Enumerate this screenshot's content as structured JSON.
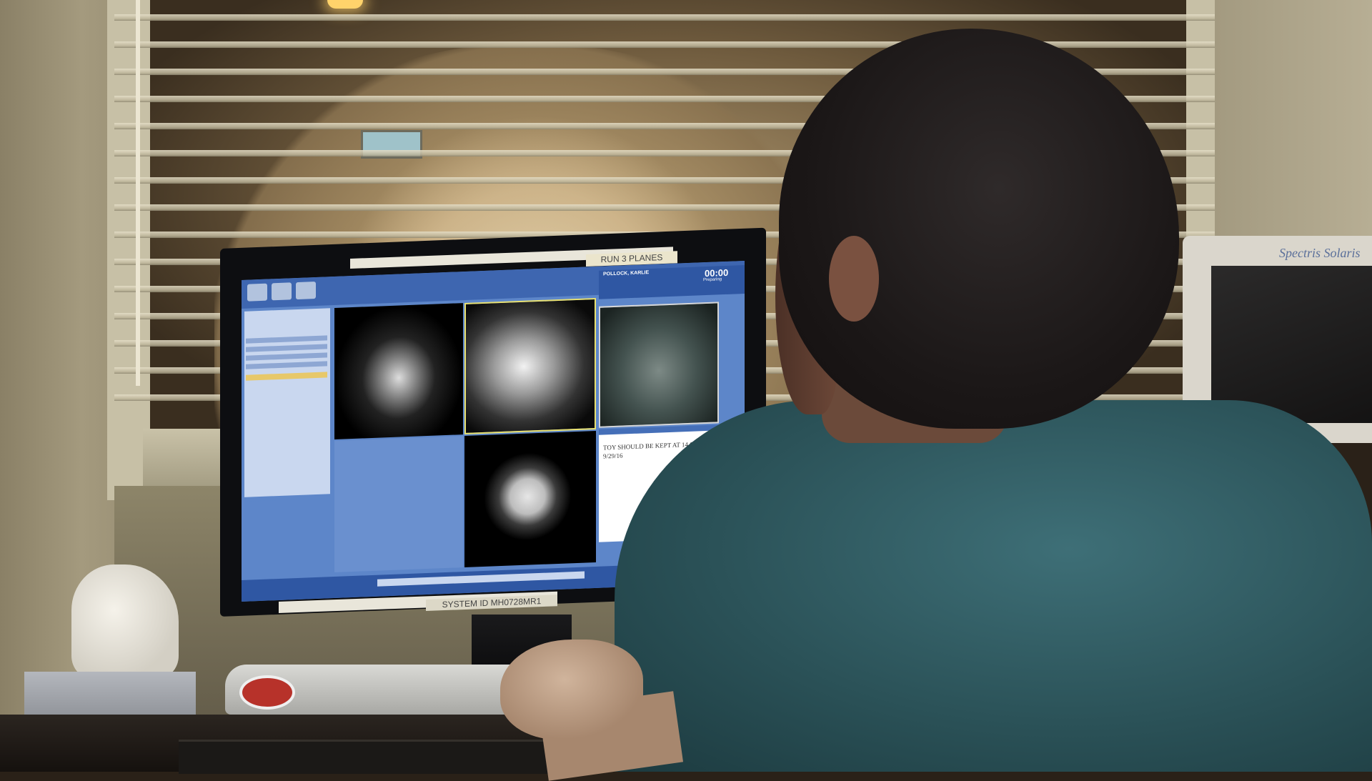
{
  "scene": {
    "monitor": {
      "label_top_right": "RUN 3 PLANES",
      "label_bottom_right": "SYSTEM ID MH0728MR1"
    },
    "mri_console": {
      "patient_name": "POLLOCK, KARLIE",
      "scan_time": "00:00",
      "scan_status": "Preparing",
      "technologist_note": "TOY SHOULD BE KEPT AT 14 CMS PER NRAD 9/29/16"
    },
    "side_monitor_brand": "Spectris Solaris"
  }
}
